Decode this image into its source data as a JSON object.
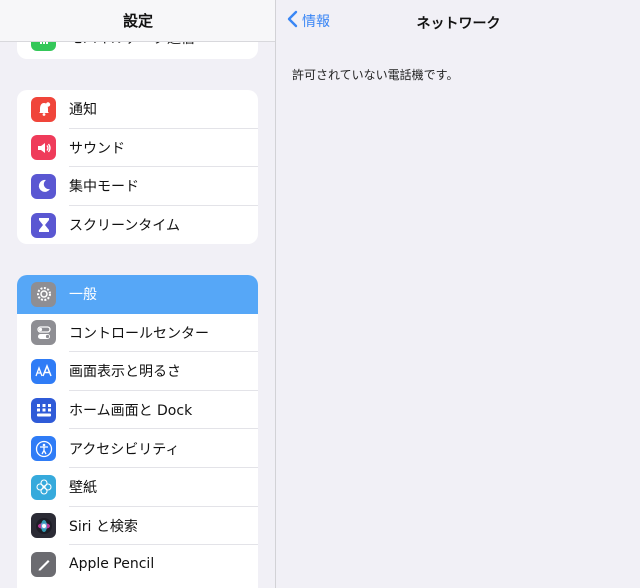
{
  "sidebar": {
    "title": "設定",
    "partial_row": {
      "label": "モバイルデータ通信",
      "icon": "antenna-icon",
      "color": "#34c759"
    },
    "group1": [
      {
        "label": "通知",
        "icon": "bell-icon",
        "color": "#f0453a"
      },
      {
        "label": "サウンド",
        "icon": "speaker-icon",
        "color": "#ef3b5a"
      },
      {
        "label": "集中モード",
        "icon": "moon-icon",
        "color": "#5a57d2"
      },
      {
        "label": "スクリーンタイム",
        "icon": "hourglass-icon",
        "color": "#5a57d2"
      }
    ],
    "group2": [
      {
        "label": "一般",
        "icon": "gear-icon",
        "color": "#8e8e93",
        "selected": true
      },
      {
        "label": "コントロールセンター",
        "icon": "toggles-icon",
        "color": "#8e8e93"
      },
      {
        "label": "画面表示と明るさ",
        "icon": "text-size-icon",
        "color": "#2f7cf6"
      },
      {
        "label": "ホーム画面と Dock",
        "icon": "home-grid-icon",
        "color": "#2f5bd8"
      },
      {
        "label": "アクセシビリティ",
        "icon": "accessibility-icon",
        "color": "#2f7cf6"
      },
      {
        "label": "壁紙",
        "icon": "flower-icon",
        "color": "#36aadc"
      },
      {
        "label": "Siri と検索",
        "icon": "siri-icon",
        "color": "#2b2b35"
      },
      {
        "label": "Apple Pencil",
        "icon": "pencil-icon",
        "color": "#6b6b70"
      }
    ]
  },
  "detail": {
    "back_label": "情報",
    "title": "ネットワーク",
    "message": "許可されていない電話機です。"
  },
  "colors": {
    "accent": "#3a86f5",
    "selected_row": "#56a7f7",
    "background": "#f1f0f6"
  }
}
